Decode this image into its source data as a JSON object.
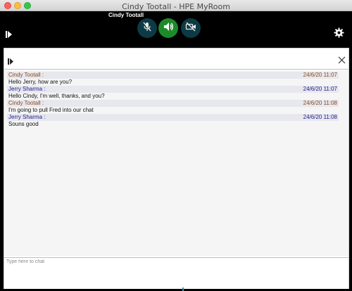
{
  "window": {
    "title": "Cindy Tootall - HPE MyRoom"
  },
  "call": {
    "presenter_name": "Cindy Tootall",
    "controls": [
      {
        "name": "microphone",
        "state": "muted",
        "icon": "mic-off-icon",
        "color": "#0d3a45"
      },
      {
        "name": "speaker",
        "state": "on",
        "icon": "speaker-icon",
        "color": "#1d8a2a"
      },
      {
        "name": "video",
        "state": "off",
        "icon": "video-off-icon",
        "color": "#0d3a45"
      }
    ]
  },
  "chat": {
    "messages": [
      {
        "sender": "Cindy Tootall :",
        "time": "24/6/20 11:07",
        "text": "Hello Jerry, how are you?",
        "color": "#8a4a1a"
      },
      {
        "sender": "Jerry Sharma :",
        "time": "24/6/20 11:07",
        "text": "Hello Cindy, I'm well, thanks, and you?",
        "color": "#1a1a8a"
      },
      {
        "sender": "Cindy Tootall :",
        "time": "24/6/20 11:08",
        "text": "I'm going to pull Fred into our chat",
        "color": "#8a4a1a"
      },
      {
        "sender": "Jerry Sharma :",
        "time": "24/6/20 11:08",
        "text": "Souns good",
        "color": "#1a1a8a"
      }
    ],
    "input": {
      "placeholder": "Type here to chat",
      "value": ""
    }
  }
}
